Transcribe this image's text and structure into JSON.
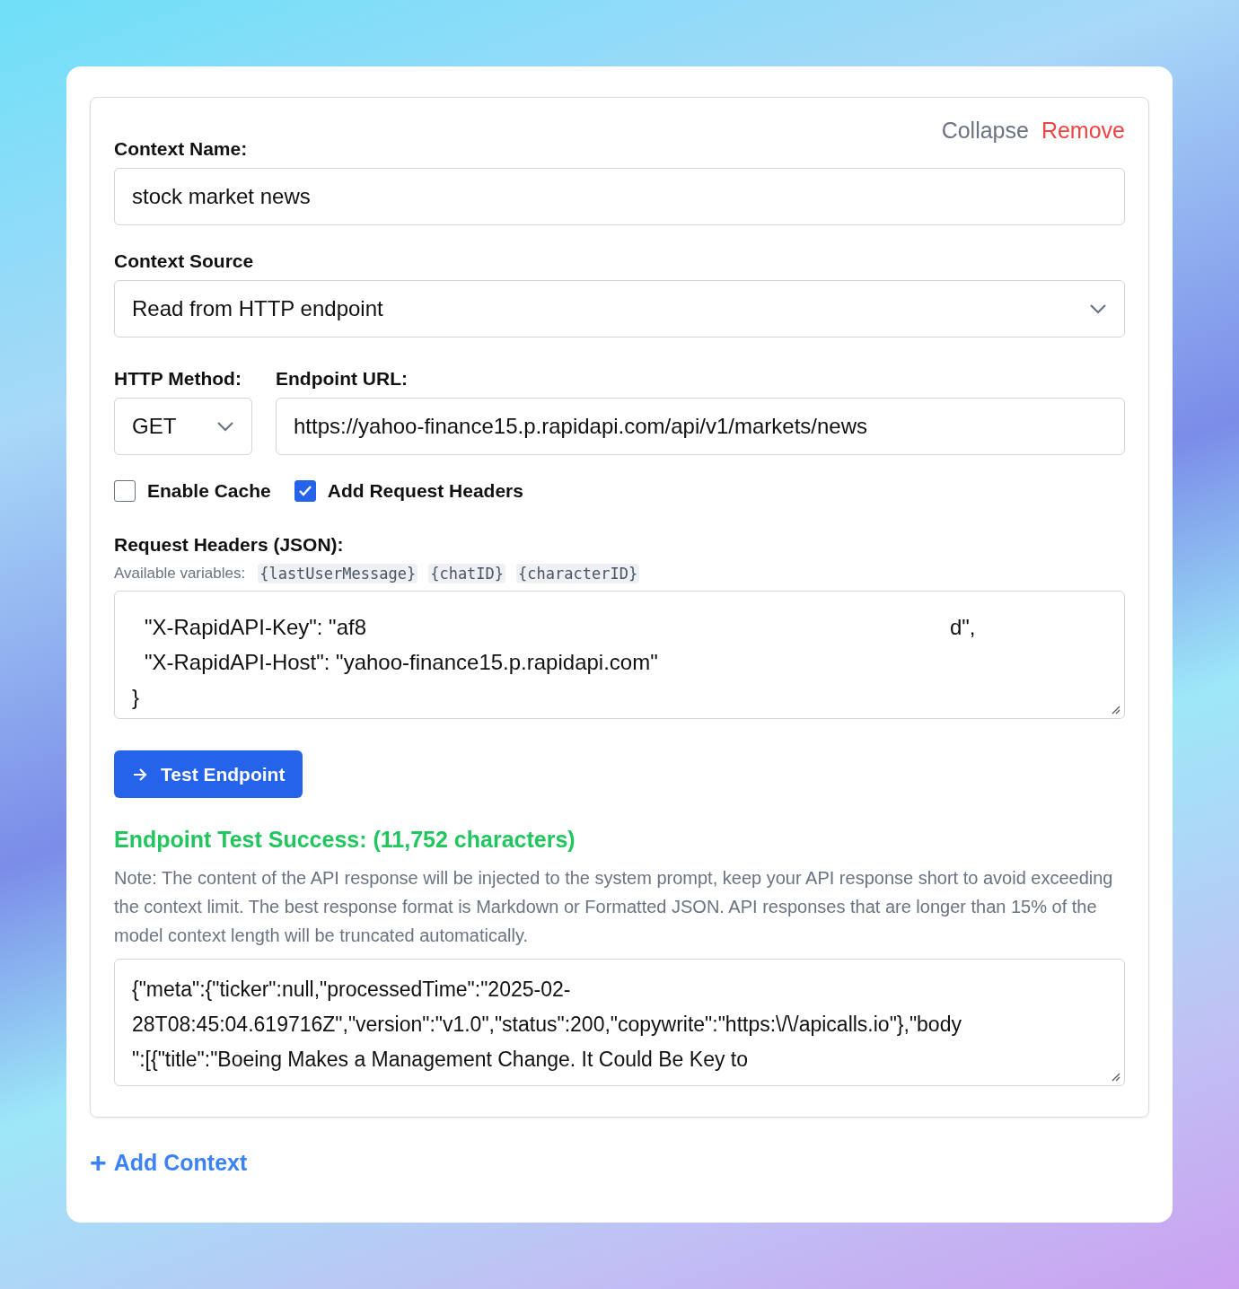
{
  "actions": [
    {
      "label": "Collapse",
      "kind": "neutral"
    },
    {
      "label": "Remove",
      "kind": "danger"
    }
  ],
  "context_name": {
    "label": "Context Name:",
    "value": "stock market news"
  },
  "context_source": {
    "label": "Context Source",
    "value": "Read from HTTP endpoint"
  },
  "http_method": {
    "label": "HTTP Method:",
    "value": "GET"
  },
  "endpoint_url": {
    "label": "Endpoint URL:",
    "value": "https://yahoo-finance15.p.rapidapi.com/api/v1/markets/news"
  },
  "options": [
    {
      "label": "Enable Cache",
      "checked": false
    },
    {
      "label": "Add Request Headers",
      "checked": true
    }
  ],
  "request_headers": {
    "label": "Request Headers (JSON):",
    "variables_label": "Available variables:",
    "variables": [
      "{lastUserMessage}",
      "{chatID}",
      "{characterID}"
    ],
    "lines": [
      {
        "start": "\"X-RapidAPI-Key\": \"af8",
        "end": "d\","
      },
      {
        "start": "\"X-RapidAPI-Host\": \"yahoo-finance15.p.rapidapi.com\""
      },
      {
        "start": "}"
      }
    ]
  },
  "test_button": "Test Endpoint",
  "result": {
    "title": "Endpoint Test Success: (11,752 characters)",
    "note": "Note: The content of the API response will be injected to the system prompt, keep your API response short to avoid exceeding the context limit. The best response format is Markdown or Formatted JSON. API responses that are longer than 15% of the model context length will be truncated automatically.",
    "response_lines": [
      "{\"meta\":{\"ticker\":null,\"processedTime\":\"2025-02-",
      "28T08:45:04.619716Z\",\"version\":\"v1.0\",\"status\":200,\"copywrite\":\"https:\\/\\/apicalls.io\"},\"body",
      "\":[{\"title\":\"Boeing Makes a Management Change. It Could Be Key to"
    ]
  },
  "add_context": {
    "icon": "+",
    "label": "Add Context"
  }
}
